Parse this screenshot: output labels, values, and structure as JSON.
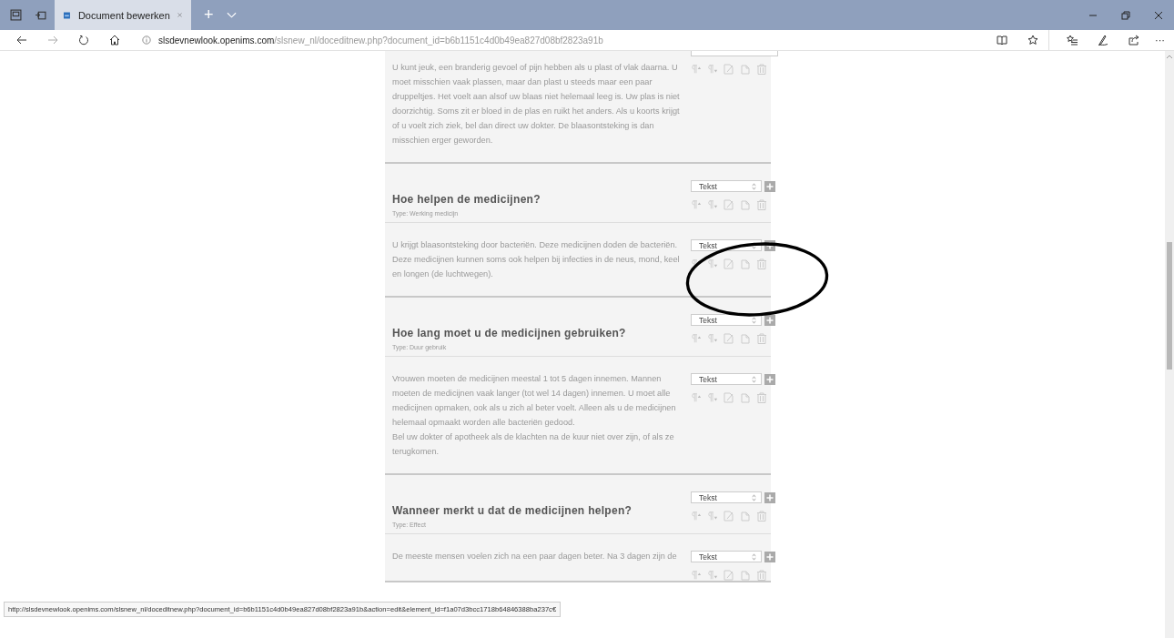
{
  "browser": {
    "tab_title": "Document bewerken",
    "url_host": "slsdevnewlook.openims.com",
    "url_path": "/slsnew_nl/doceditnew.php?document_id=b6b1151c4d0b49ea827d08bf2823a91b",
    "new_tab": "+",
    "more": "···"
  },
  "blocks": [
    {
      "kind": "text",
      "paragraphs": [
        "U kunt jeuk, een branderig gevoel of pijn hebben als u plast of vlak daarna. U moet misschien vaak plassen, maar dan plast u steeds maar een paar druppeltjes. Het voelt aan alsof uw blaas niet helemaal leeg is. Uw plas is niet doorzichtig. Soms zit er bloed in de plas en ruikt het anders. Als u koorts krijgt of u voelt zich ziek, bel dan direct uw dokter. De blaasontsteking is dan misschien erger geworden."
      ]
    },
    {
      "kind": "heading",
      "select": "Tekst",
      "title": "Hoe helpen de medicijnen?",
      "type": "Type: Werking medicijn"
    },
    {
      "kind": "text",
      "select": "Tekst",
      "paragraphs": [
        "U krijgt blaasontsteking door bacteriën. Deze medicijnen doden de bacteriën.",
        "Deze medicijnen kunnen soms ook helpen bij infecties in de neus, mond, keel en longen (de luchtwegen)."
      ]
    },
    {
      "kind": "heading",
      "select": "Tekst",
      "title": "Hoe lang moet u de medicijnen gebruiken?",
      "type": "Type: Duur gebruik"
    },
    {
      "kind": "text",
      "select": "Tekst",
      "paragraphs": [
        "Vrouwen moeten de medicijnen meestal 1 tot 5 dagen innemen. Mannen moeten de medicijnen vaak langer (tot wel 14 dagen) innemen. U moet alle medicijnen opmaken, ook als u zich al beter voelt. Alleen als u de medicijnen helemaal opmaakt worden alle bacteriën gedood.",
        "Bel uw dokter of apotheek als de klachten na de kuur niet over zijn, of als ze terugkomen."
      ]
    },
    {
      "kind": "heading",
      "select": "Tekst",
      "title": "Wanneer merkt u dat de medicijnen helpen?",
      "type": "Type: Effect"
    },
    {
      "kind": "text",
      "select": "Tekst",
      "paragraphs": [
        "De meeste mensen voelen zich na een paar dagen beter. Na 3 dagen zijn de"
      ]
    }
  ],
  "status_url": "http://slsdevnewlook.openims.com/slsnew_nl/doceditnew.php?document_id=b6b1151c4d0b49ea827d08bf2823a91b&action=edit&element_id=f1a07d3bcc1718b64846388ba237c€"
}
